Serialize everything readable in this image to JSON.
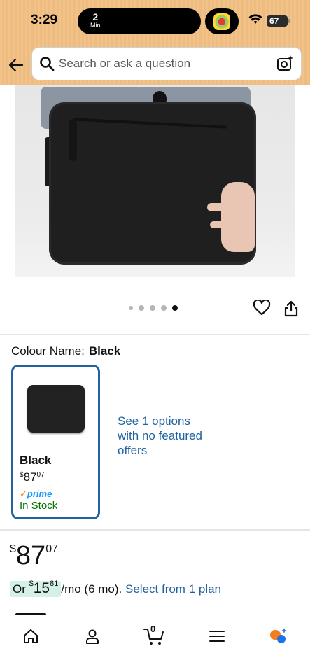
{
  "status_bar": {
    "time": "3:29",
    "timer_value": "2",
    "timer_unit": "Min",
    "battery": "67"
  },
  "header": {
    "search_placeholder": "Search or ask a question",
    "icons": [
      "back-arrow-icon",
      "search-icon",
      "camera-lens-icon"
    ]
  },
  "gallery": {
    "image_count": 5,
    "active_index": 4
  },
  "colour": {
    "label": "Colour Name:",
    "selected": "Black",
    "options": [
      {
        "name": "Black",
        "price_currency": "$",
        "price_whole": "87",
        "price_fraction": "07",
        "prime": "prime",
        "availability": "In Stock"
      }
    ],
    "more_options_text": "See 1 options with no featured offers"
  },
  "price": {
    "currency": "$",
    "whole": "87",
    "fraction": "07"
  },
  "installment": {
    "prefix": "Or",
    "currency": "$",
    "whole": "15",
    "fraction": "81",
    "suffix": "/mo (6 mo).",
    "plan_link": "Select from 1 plan"
  },
  "tab_bar": {
    "cart_count": "0",
    "items": [
      "home-icon",
      "account-icon",
      "cart-icon",
      "menu-icon",
      "rufus-icon"
    ]
  },
  "colors": {
    "header_bg": "#f2c389",
    "link": "#2162a1",
    "in_stock": "#007600",
    "prime_blue": "#1399ff",
    "installment_bg": "#d5f0e6"
  }
}
